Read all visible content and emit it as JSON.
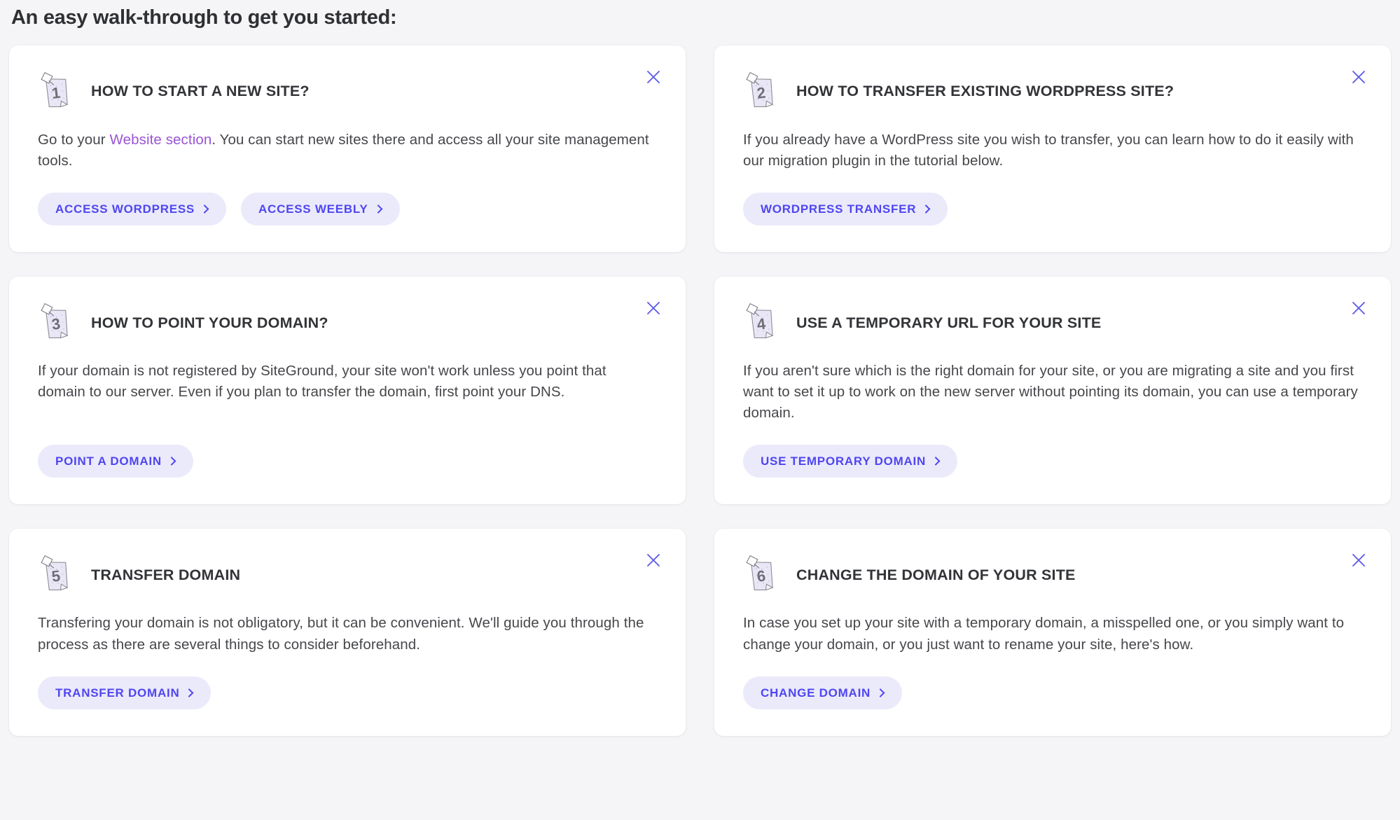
{
  "page": {
    "heading": "An easy walk-through to get you started:",
    "background_color": "#f5f5f7",
    "card_background": "#ffffff",
    "accent_color": "#4f46f0",
    "button_background": "#ebeafb",
    "link_color": "#9a55d4",
    "close_icon_color": "#5f5be8"
  },
  "cards": [
    {
      "number": "1",
      "note_icon": "numbered-sticky-note-icon",
      "close_icon": "close-icon",
      "title": "HOW TO START A NEW SITE?",
      "body_pre": "Go to your ",
      "body_link": "Website section",
      "body_post": ". You can start new sites there and access all your site management tools.",
      "buttons": [
        {
          "label": "ACCESS WORDPRESS",
          "icon": "chevron-right-icon"
        },
        {
          "label": "ACCESS WEEBLY",
          "icon": "chevron-right-icon"
        }
      ]
    },
    {
      "number": "2",
      "note_icon": "numbered-sticky-note-icon",
      "close_icon": "close-icon",
      "title": "HOW TO TRANSFER EXISTING WORDPRESS SITE?",
      "body": "If you already have a WordPress site you wish to transfer, you can learn how to do it easily with our migration plugin in the tutorial below.",
      "buttons": [
        {
          "label": "WORDPRESS TRANSFER",
          "icon": "chevron-right-icon"
        }
      ]
    },
    {
      "number": "3",
      "note_icon": "numbered-sticky-note-icon",
      "close_icon": "close-icon",
      "title": "HOW TO POINT YOUR DOMAIN?",
      "body": "If your domain is not registered by SiteGround, your site won't work unless you point that domain to our server. Even if you plan to transfer the domain, first point your DNS.",
      "buttons": [
        {
          "label": "POINT A DOMAIN",
          "icon": "chevron-right-icon"
        }
      ]
    },
    {
      "number": "4",
      "note_icon": "numbered-sticky-note-icon",
      "close_icon": "close-icon",
      "title": "USE A TEMPORARY URL FOR YOUR SITE",
      "body": "If you aren't sure which is the right domain for your site, or you are migrating a site and you first want to set it up to work on the new server without pointing its domain, you can use a temporary domain.",
      "buttons": [
        {
          "label": "USE TEMPORARY DOMAIN",
          "icon": "chevron-right-icon"
        }
      ]
    },
    {
      "number": "5",
      "note_icon": "numbered-sticky-note-icon",
      "close_icon": "close-icon",
      "title": "TRANSFER DOMAIN",
      "body": "Transfering your domain is not obligatory, but it can be convenient. We'll guide you through the process as there are several things to consider beforehand.",
      "buttons": [
        {
          "label": "TRANSFER DOMAIN",
          "icon": "chevron-right-icon"
        }
      ]
    },
    {
      "number": "6",
      "note_icon": "numbered-sticky-note-icon",
      "close_icon": "close-icon",
      "title": "CHANGE THE DOMAIN OF YOUR SITE",
      "body": "In case you set up your site with a temporary domain, a misspelled one, or you simply want to change your domain, or you just want to rename your site, here's how.",
      "buttons": [
        {
          "label": "CHANGE DOMAIN",
          "icon": "chevron-right-icon"
        }
      ]
    }
  ]
}
